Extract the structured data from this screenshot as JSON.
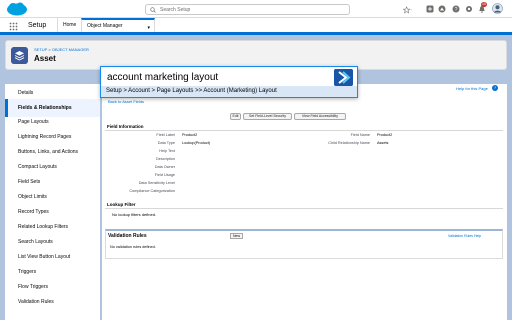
{
  "header": {
    "search_placeholder": "Search Setup",
    "notification_count": "10"
  },
  "nav": {
    "app_name": "Setup",
    "tabs": [
      {
        "label": "Home"
      },
      {
        "label": "Object Manager"
      }
    ]
  },
  "page_header": {
    "breadcrumb_setup": "SETUP",
    "breadcrumb_sep": " > ",
    "breadcrumb_om": "OBJECT MANAGER",
    "title": "Asset"
  },
  "sidebar": {
    "items": [
      {
        "label": "Details"
      },
      {
        "label": "Fields & Relationships"
      },
      {
        "label": "Page Layouts"
      },
      {
        "label": "Lightning Record Pages"
      },
      {
        "label": "Buttons, Links, and Actions"
      },
      {
        "label": "Compact Layouts"
      },
      {
        "label": "Field Sets"
      },
      {
        "label": "Object Limits"
      },
      {
        "label": "Record Types"
      },
      {
        "label": "Related Lookup Filters"
      },
      {
        "label": "Search Layouts"
      },
      {
        "label": "List View Button Layout"
      },
      {
        "label": "Triggers"
      },
      {
        "label": "Flow Triggers"
      },
      {
        "label": "Validation Rules"
      }
    ]
  },
  "main": {
    "help_link": "Help for this Page",
    "back_link": "Back to Asset Fields",
    "buttons": {
      "edit": "Edit",
      "field_security": "Set Field-Level Security",
      "accessibility": "View Field Accessibility"
    },
    "field_info": {
      "title": "Field Information",
      "left_rows": [
        {
          "label": "Field Label",
          "value": "Product2"
        },
        {
          "label": "Data Type",
          "value": "Lookup(Product)"
        },
        {
          "label": "Help Text",
          "value": ""
        },
        {
          "label": "Description",
          "value": ""
        },
        {
          "label": "Data Owner",
          "value": ""
        },
        {
          "label": "Field Usage",
          "value": ""
        },
        {
          "label": "Data Sensitivity Level",
          "value": ""
        },
        {
          "label": "Compliance Categorization",
          "value": ""
        }
      ],
      "right_rows": [
        {
          "label": "Field Name",
          "value": "Product2"
        },
        {
          "label": "Child Relationship Name",
          "value": "Assets"
        }
      ]
    },
    "lookup_filter": {
      "title": "Lookup Filter",
      "empty": "No lookup filters defined."
    },
    "validation_rules": {
      "title": "Validation Rules",
      "new_button": "New",
      "help": "Validation Rules Help",
      "empty": "No validation rules defined."
    }
  },
  "command_palette": {
    "query": "account marketing layout",
    "result": "Setup > Account > Page Layouts >> Account (Marketing) Layout"
  },
  "colors": {
    "brand": "#0070d2",
    "background": "#b0c4df",
    "object_icon": "#3c5a99"
  }
}
